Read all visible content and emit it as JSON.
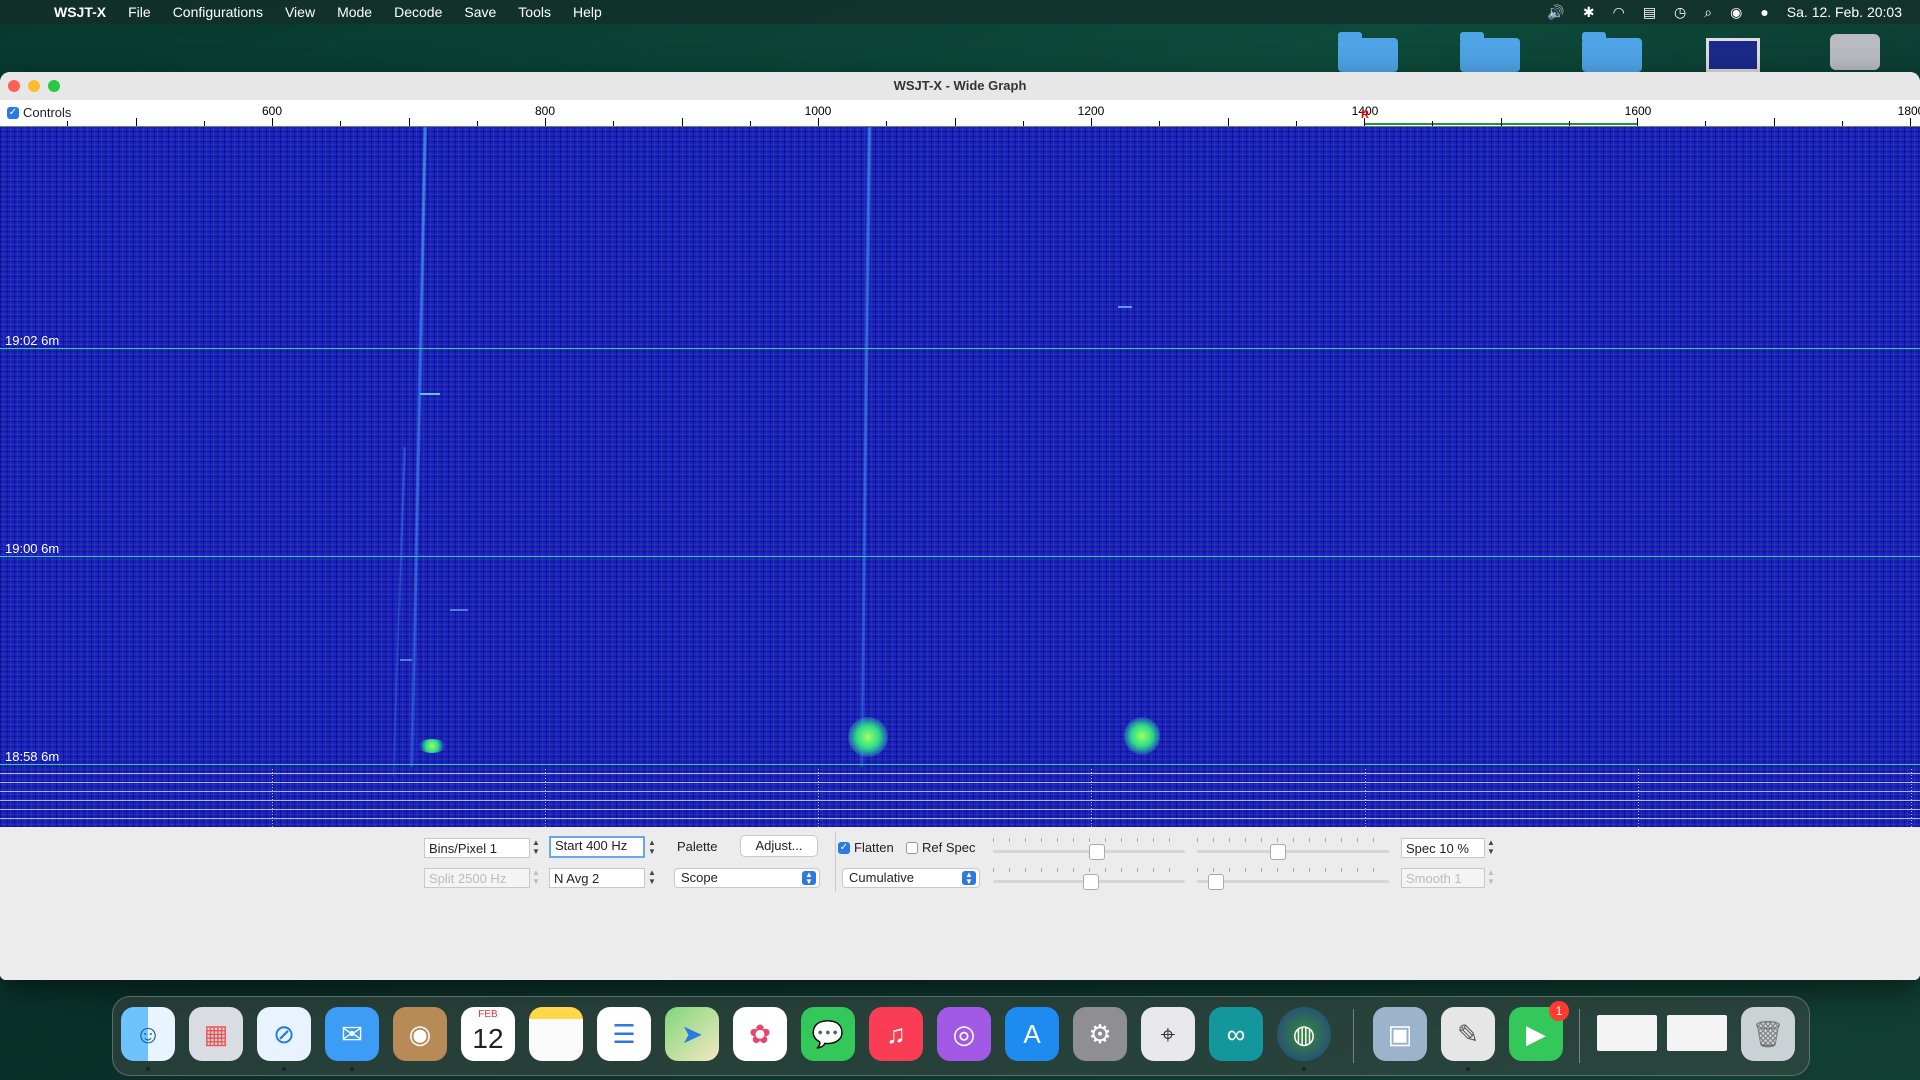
{
  "menubar": {
    "app_name": "WSJT-X",
    "items": [
      "File",
      "Configurations",
      "View",
      "Mode",
      "Decode",
      "Save",
      "Tools",
      "Help"
    ],
    "datetime": "Sa. 12. Feb.  20:03",
    "status_icons": [
      "volume-icon",
      "bluetooth-icon",
      "wifi-icon",
      "keyboard-icon",
      "time-machine-icon",
      "search-icon",
      "control-center-icon",
      "siri-icon"
    ]
  },
  "window": {
    "title": "WSJT-X - Wide Graph"
  },
  "scale": {
    "controls_label": "Controls",
    "controls_checked": true,
    "labels": [
      "600",
      "800",
      "1000",
      "1200",
      "1400",
      "1600",
      "1800"
    ],
    "marker_label": "R"
  },
  "waterfall": {
    "time_labels": [
      "19:02   6m",
      "19:00   6m",
      "18:58   6m"
    ]
  },
  "controls": {
    "bins_label": "Bins/Pixel  1",
    "start_label": "Start 400 Hz",
    "split_label": "Split  2500  Hz",
    "navg_label": "N Avg 2",
    "palette_label": "Palette",
    "adjust_button": "Adjust...",
    "palette_select": "Scope",
    "flatten_label": "Flatten",
    "flatten_checked": true,
    "refspec_label": "Ref Spec",
    "refspec_checked": false,
    "spectrum_select": "Cumulative",
    "spec_label": "Spec 10 %",
    "smooth_label": "Smooth  1"
  },
  "dock": {
    "calendar_month": "FEB",
    "calendar_day": "12",
    "facetime_badge": "1",
    "apps": [
      "finder-icon",
      "launchpad-icon",
      "safari-icon",
      "mail-icon",
      "contacts-icon",
      "calendar-icon",
      "notes-icon",
      "reminders-icon",
      "maps-icon",
      "photos-icon",
      "messages-icon",
      "music-icon",
      "podcasts-icon",
      "app-store-icon",
      "system-preferences-icon",
      "screenshot-icon",
      "arduino-icon",
      "wsjtx-icon",
      "preview-icon",
      "script-editor-icon",
      "facetime-icon",
      "document-thumb-1",
      "document-thumb-2",
      "trash-icon"
    ]
  }
}
